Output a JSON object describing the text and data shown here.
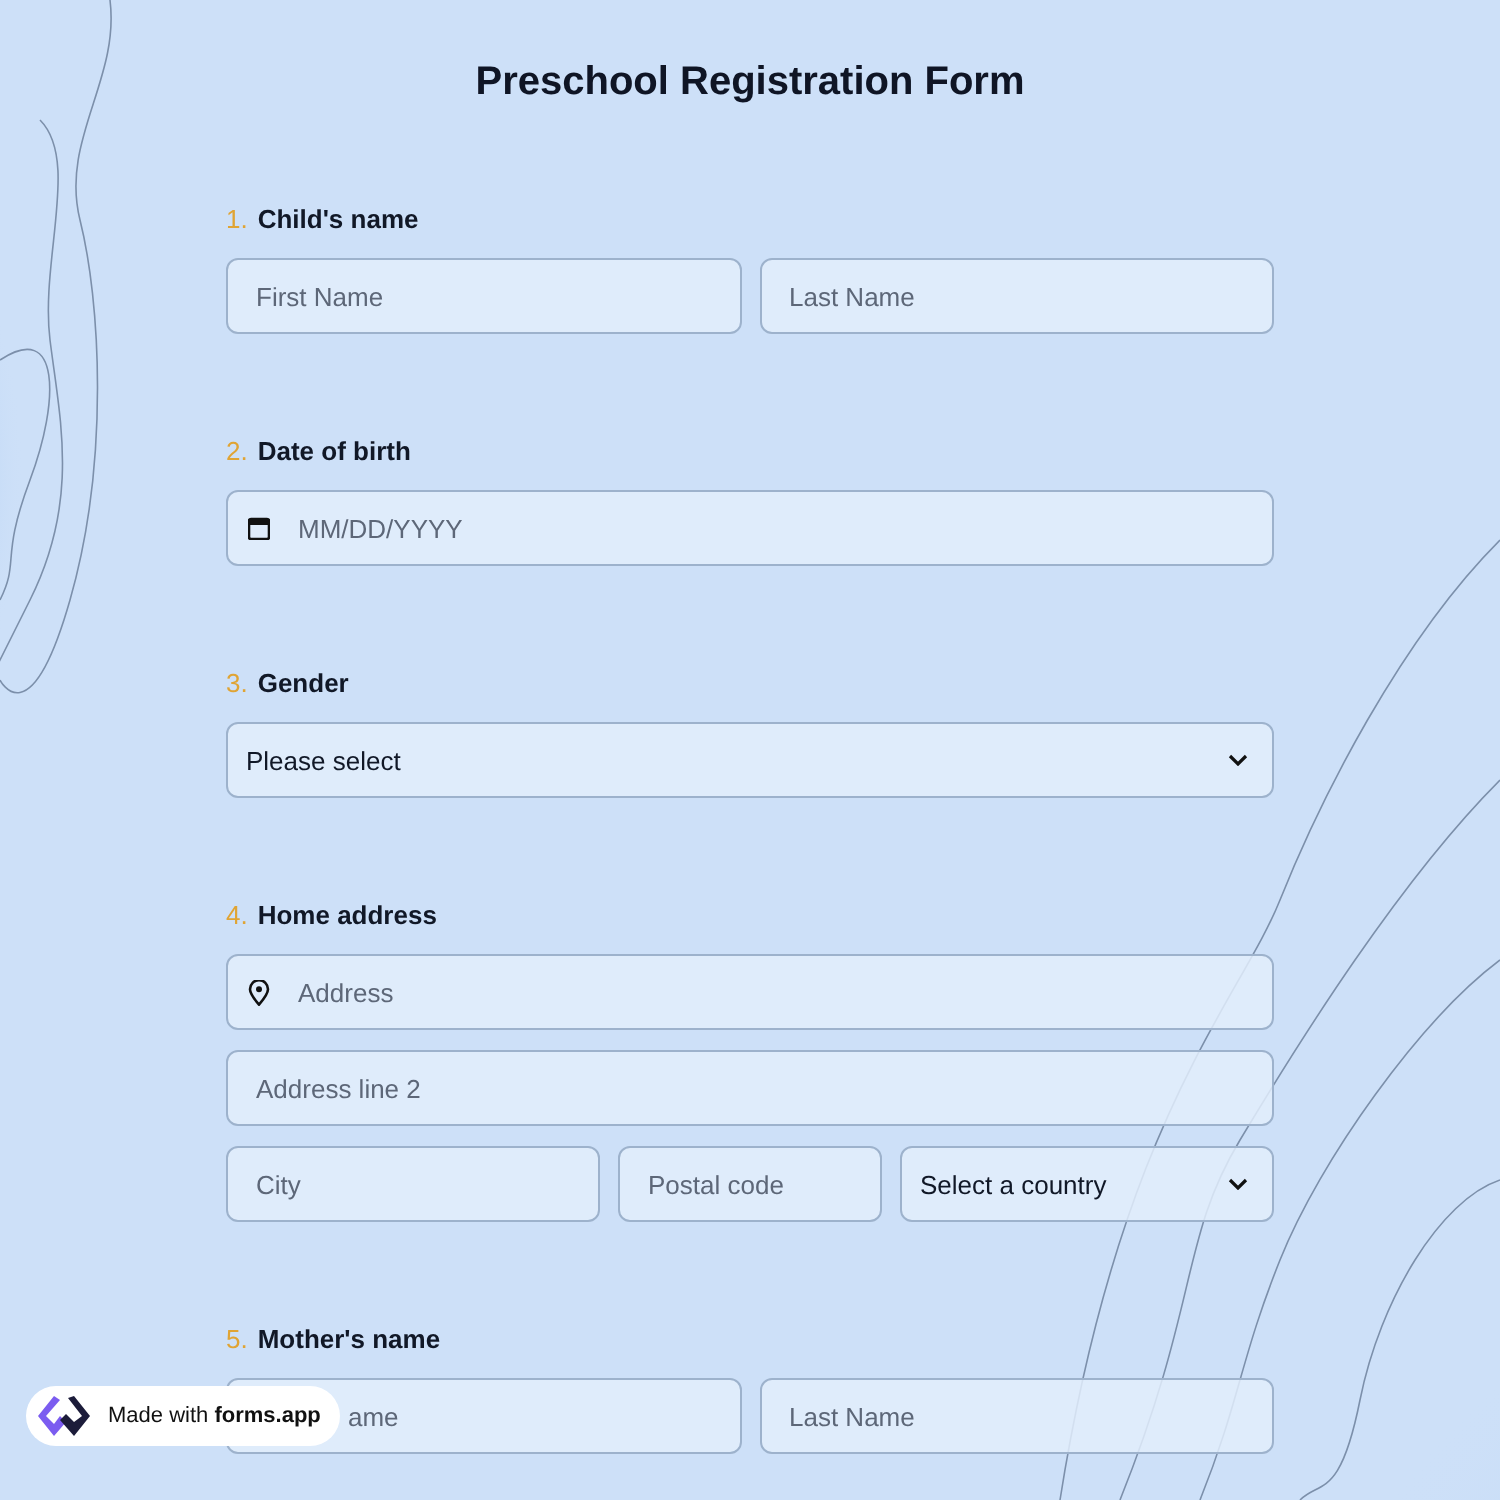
{
  "form": {
    "title": "Preschool Registration Form",
    "questions": [
      {
        "number": "1.",
        "label": "Child's name",
        "rows": [
          [
            {
              "kind": "text",
              "placeholder": "First Name"
            },
            {
              "kind": "text",
              "placeholder": "Last Name"
            }
          ]
        ]
      },
      {
        "number": "2.",
        "label": "Date of birth",
        "rows": [
          [
            {
              "kind": "date",
              "placeholder": "MM/DD/YYYY"
            }
          ]
        ]
      },
      {
        "number": "3.",
        "label": "Gender",
        "rows": [
          [
            {
              "kind": "select",
              "value": "Please select"
            }
          ]
        ]
      },
      {
        "number": "4.",
        "label": "Home address",
        "rows": [
          [
            {
              "kind": "location",
              "placeholder": "Address"
            }
          ],
          [
            {
              "kind": "text",
              "placeholder": "Address line 2"
            }
          ],
          [
            {
              "kind": "text",
              "placeholder": "City"
            },
            {
              "kind": "text",
              "placeholder": "Postal code"
            },
            {
              "kind": "select",
              "value": "Select a country"
            }
          ]
        ]
      },
      {
        "number": "5.",
        "label": "Mother's name",
        "rows": [
          [
            {
              "kind": "hidden-text",
              "placeholder": "ame"
            },
            {
              "kind": "text",
              "placeholder": "Last Name"
            }
          ]
        ]
      }
    ]
  },
  "badge": {
    "text": "Made with **forms.app**"
  }
}
